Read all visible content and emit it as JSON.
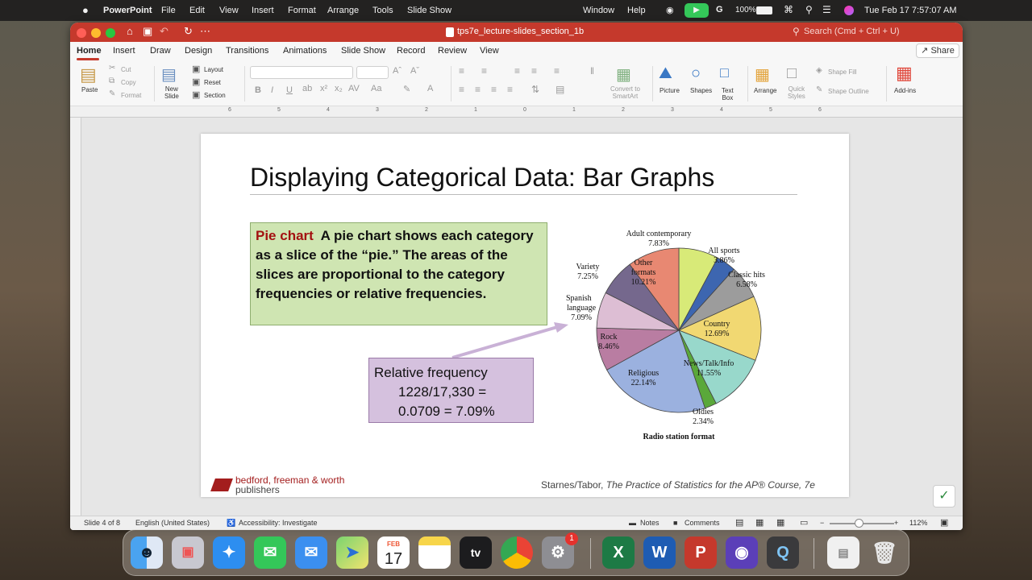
{
  "menubar": {
    "app": "PowerPoint",
    "items": [
      "File",
      "Edit",
      "View",
      "Insert",
      "Format",
      "Arrange",
      "Tools",
      "Slide Show"
    ],
    "right_items": [
      "Window",
      "Help"
    ],
    "battery": "100%",
    "clock": "Tue Feb 17  7:57:07 AM"
  },
  "window": {
    "title": "tps7e_lecture-slides_section_1b",
    "search_placeholder": "Search (Cmd + Ctrl + U)"
  },
  "tabs": {
    "items": [
      "Home",
      "Insert",
      "Draw",
      "Design",
      "Transitions",
      "Animations",
      "Slide Show",
      "Record",
      "Review",
      "View"
    ],
    "active": "Home",
    "share": "Share"
  },
  "ribbon": {
    "paste": "Paste",
    "cut": "Cut",
    "copy": "Copy",
    "format": "Format",
    "new_slide": "New\nSlide",
    "layout": "Layout",
    "reset": "Reset",
    "section": "Section",
    "bold": "B",
    "italic": "I",
    "underline": "U",
    "convert_smartart": "Convert to\nSmartArt",
    "picture": "Picture",
    "shapes": "Shapes",
    "text_box": "Text\nBox",
    "arrange": "Arrange",
    "quick_styles": "Quick\nStyles",
    "shape_fill": "Shape Fill",
    "shape_outline": "Shape Outline",
    "addins": "Add-ins"
  },
  "ruler": {
    "labels": [
      "6",
      "5",
      "4",
      "3",
      "2",
      "1",
      "0",
      "1",
      "2",
      "3",
      "4",
      "5",
      "6"
    ]
  },
  "slide": {
    "title": "Displaying Categorical Data:  Bar Graphs",
    "definition_term": "Pie chart",
    "definition_text": "A  pie chart  shows each category as a slice of the “pie.” The areas of the slices are proportional to the category frequencies or relative frequencies.",
    "calc_line1": "Relative frequency",
    "calc_line2": "1228/17,330 =",
    "calc_line3": "0.0709 = 7.09%",
    "logo_line1": "bedford, freeman & worth",
    "logo_line2": "publishers",
    "citation_author": "Starnes/Tabor,",
    "citation_title": "The Practice of Statistics for the AP® Course, 7e"
  },
  "chart_data": {
    "type": "pie",
    "title": "",
    "xlabel": "Radio station format",
    "categories": [
      "Adult contemporary",
      "All sports",
      "Classic hits",
      "Country",
      "News/Talk/Info",
      "Oldies",
      "Religious",
      "Rock",
      "Spanish language",
      "Variety",
      "Other formats"
    ],
    "values": [
      7.83,
      3.86,
      6.58,
      12.69,
      11.55,
      2.34,
      22.14,
      8.46,
      7.09,
      7.25,
      10.21
    ],
    "value_labels": [
      "7.83%",
      "3.86%",
      "6.58%",
      "12.69%",
      "11.55%",
      "2.34%",
      "22.14%",
      "8.46%",
      "7.09%",
      "7.25%",
      "10.21%"
    ],
    "colors": [
      "#d8ea78",
      "#3d66b0",
      "#9c9c9c",
      "#f1d872",
      "#98d8cb",
      "#5aa83a",
      "#9bb1df",
      "#b97da2",
      "#ddbed4",
      "#75688d",
      "#e88872"
    ]
  },
  "status": {
    "slide": "Slide 4 of 8",
    "language": "English (United States)",
    "accessibility": "Accessibility: Investigate",
    "notes": "Notes",
    "comments": "Comments",
    "zoom": "112%"
  },
  "dock": {
    "calendar_month": "FEB",
    "calendar_day": "17",
    "settings_badge": "1"
  }
}
